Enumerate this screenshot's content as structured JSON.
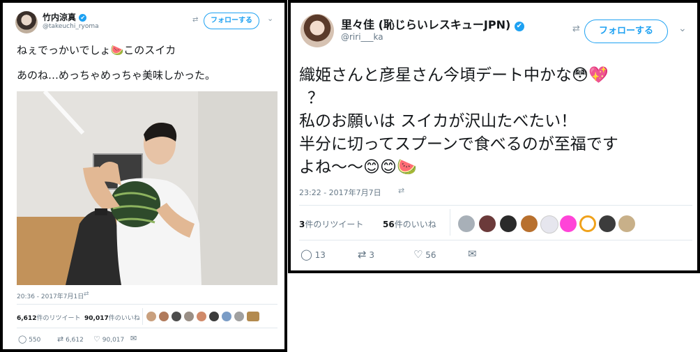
{
  "left_tweet": {
    "name": "竹内涼真",
    "handle": "@takeuchi_ryoma",
    "verified": "✔",
    "follow_label": "フォローする",
    "text_line1": "ねぇでっかいでしょ🍉このスイカ",
    "text_line2": "あのね…めっちゃめっちゃ美味しかった。",
    "timestamp": "20:36 - 2017年7月1日",
    "retweet_count": "6,612",
    "retweet_label": "件のリツイート",
    "like_count": "90,017",
    "like_label": "件のいいね",
    "action_reply": "550",
    "action_retweet": "6,612",
    "action_like": "90,017"
  },
  "right_tweet": {
    "name": "里々佳 (恥じらいレスキューJPN)",
    "handle": "@riri___ka",
    "verified": "✔",
    "follow_label": "フォローする",
    "text_line1": "織姫さんと彦星さん今頃デート中かな😳💖",
    "text_line2": "？",
    "text_line3": "私のお願いは スイカが沢山たべたい！",
    "text_line4": "半分に切ってスプーンで食べるのが至福です",
    "text_line5": "よね〜〜😊😊🍉",
    "timestamp": "23:22 - 2017年7月7日",
    "retweet_count": "3",
    "retweet_label": "件のリツイート",
    "like_count": "56",
    "like_label": "件のいいね",
    "action_reply": "13",
    "action_retweet": "3",
    "action_like": "56"
  },
  "colors": {
    "accent": "#1da1f2",
    "muted": "#657786",
    "divider": "#e1e8ed"
  },
  "icons": [
    "verified-badge-icon",
    "chevron-down-icon",
    "follow-add-icon",
    "share-icon",
    "reply-icon",
    "retweet-icon",
    "like-icon",
    "dm-icon"
  ]
}
